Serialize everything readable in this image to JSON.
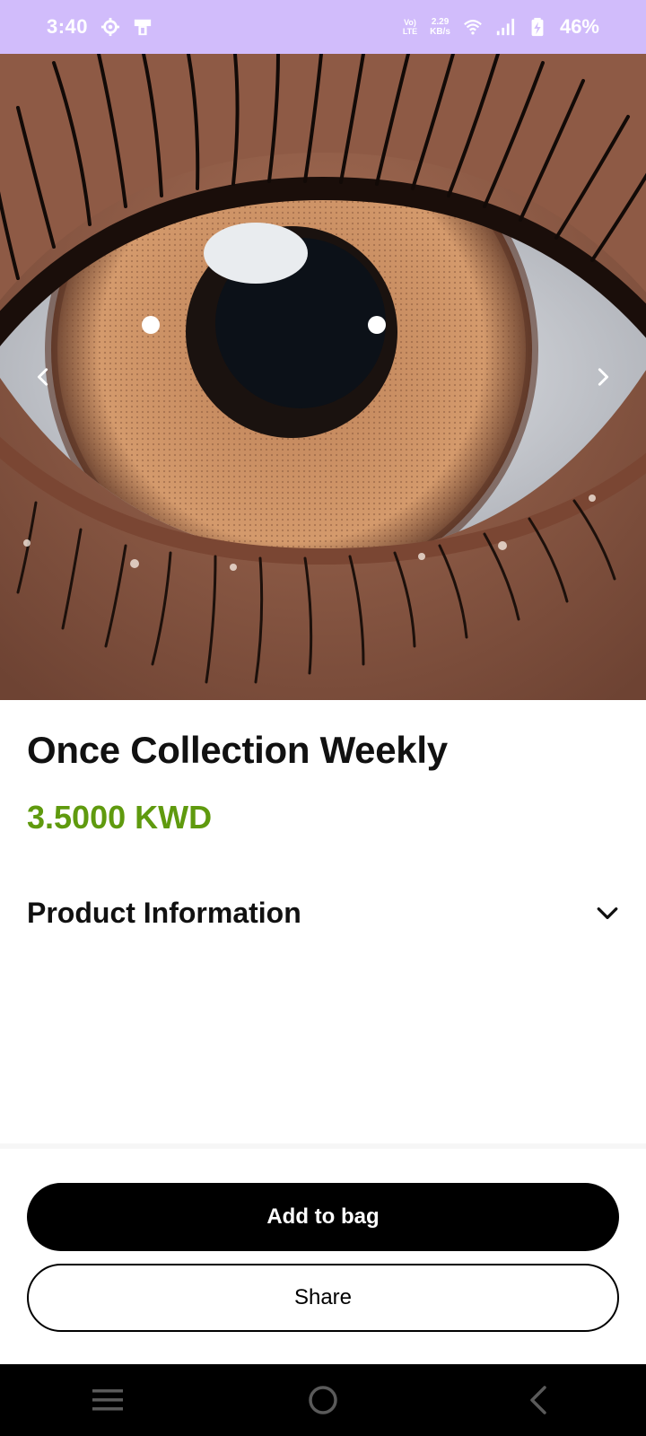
{
  "status_bar": {
    "time": "3:40",
    "volte_top": "Vo)",
    "volte_bottom": "LTE",
    "speed_value": "2.29",
    "speed_unit": "KB/s",
    "battery": "46%",
    "background": "#d1bcfb"
  },
  "hero": {
    "prev_icon": "chevron-left-icon",
    "next_icon": "chevron-right-icon"
  },
  "product": {
    "title": "Once Collection Weekly",
    "price": "3.5000 KWD",
    "price_color": "#5f9a0e"
  },
  "accordion": {
    "label": "Product Information",
    "icon": "chevron-down-icon"
  },
  "actions": {
    "add_to_bag": "Add to bag",
    "share": "Share"
  },
  "nav_bar": {
    "menu_icon": "menu-icon",
    "home_icon": "home-circle-icon",
    "back_icon": "back-icon"
  }
}
